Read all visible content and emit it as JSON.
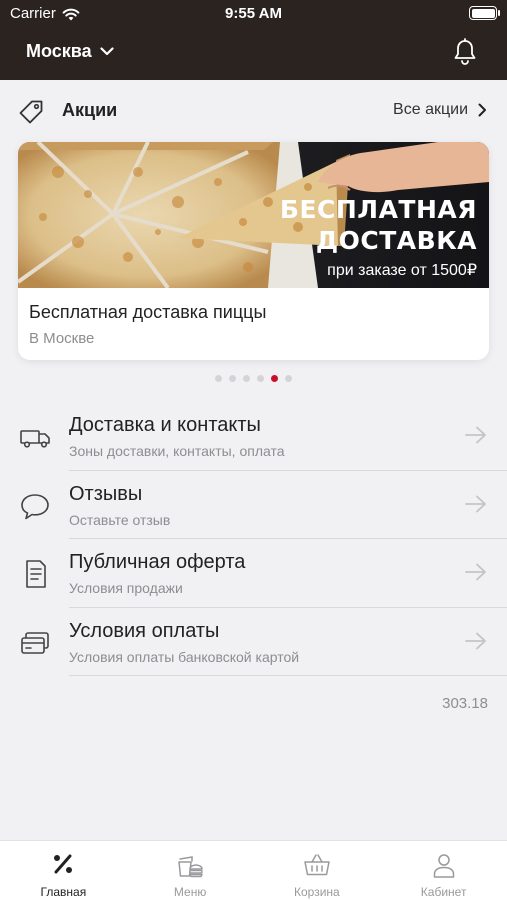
{
  "status_bar": {
    "carrier": "Carrier",
    "time": "9:55 AM"
  },
  "header": {
    "city": "Москва",
    "icons": [
      "chevron-down-icon",
      "bell-icon"
    ]
  },
  "promotions": {
    "title": "Акции",
    "all_link": "Все акции",
    "banner": {
      "line1": "БЕСПЛАТНАЯ",
      "line2": "ДОСТАВКА",
      "line3": "при заказе от 1500₽"
    },
    "card_title": "Бесплатная доставка пиццы",
    "card_subtitle": "В Москве",
    "dots_count": 6,
    "active_dot": 5
  },
  "menu": {
    "items": [
      {
        "title": "Доставка и контакты",
        "subtitle": "Зоны доставки, контакты, оплата",
        "icon": "truck-icon"
      },
      {
        "title": "Отзывы",
        "subtitle": "Оставьте отзыв",
        "icon": "chat-bubble-icon"
      },
      {
        "title": "Публичная оферта",
        "subtitle": "Условия продажи",
        "icon": "document-icon"
      },
      {
        "title": "Условия оплаты",
        "subtitle": "Условия оплаты банковской картой",
        "icon": "credit-cards-icon"
      }
    ]
  },
  "version": "303.18",
  "tabbar": {
    "tabs": [
      {
        "label": "Главная",
        "icon": "percent-icon",
        "active": true
      },
      {
        "label": "Меню",
        "icon": "food-menu-icon",
        "active": false
      },
      {
        "label": "Корзина",
        "icon": "basket-icon",
        "active": false
      },
      {
        "label": "Кабинет",
        "icon": "user-icon",
        "active": false
      }
    ]
  },
  "colors": {
    "header_bg": "#2a2320",
    "page_bg": "#f1f1f3",
    "accent": "#c8102e",
    "muted_text": "#8d8d92"
  }
}
